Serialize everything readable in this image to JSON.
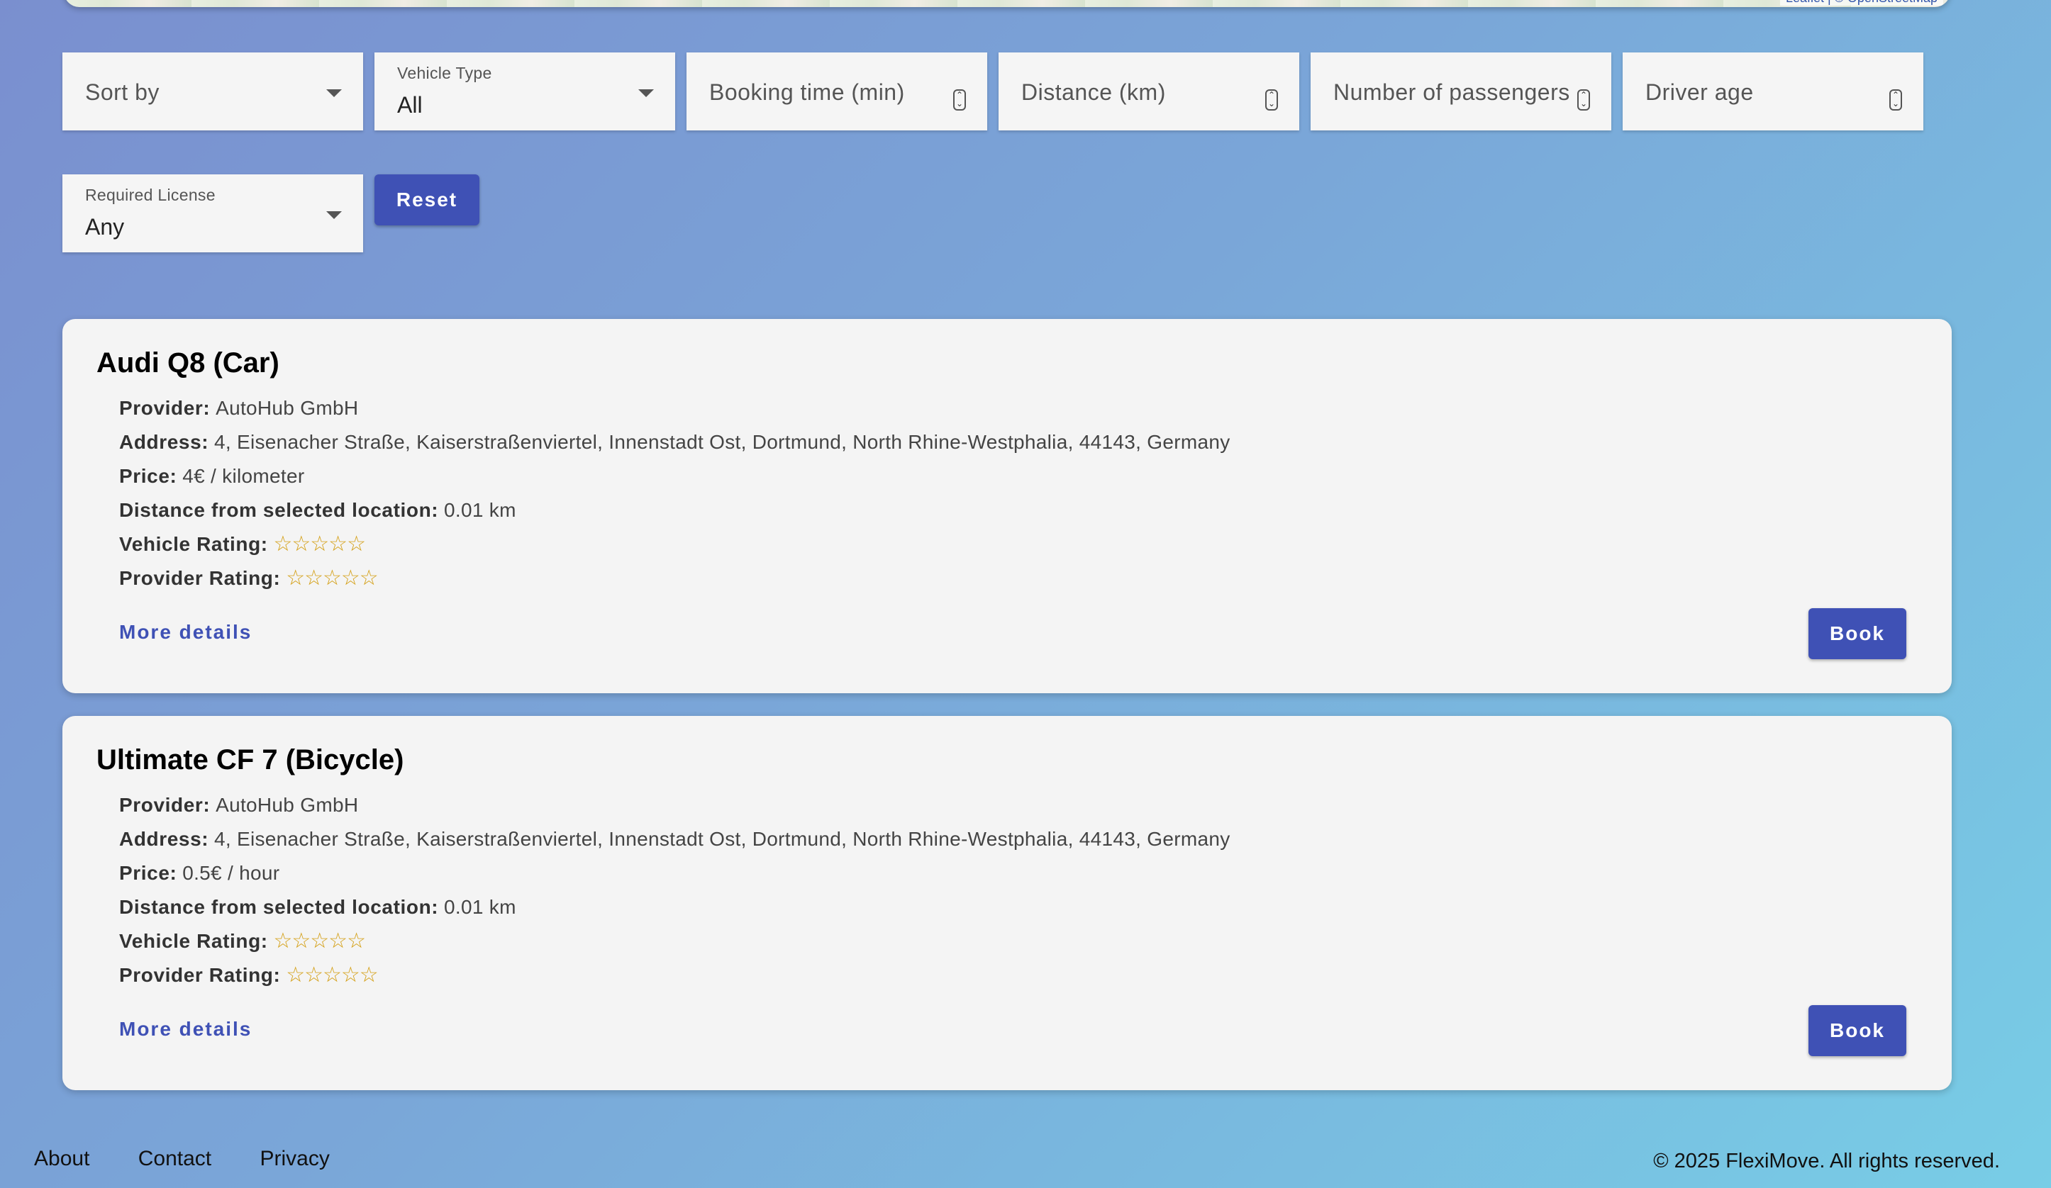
{
  "map": {
    "attribution": "Leaflet | © OpenStreetMap"
  },
  "filters": {
    "sort_by": {
      "placeholder": "Sort by"
    },
    "vehicle_type": {
      "label": "Vehicle Type",
      "value": "All"
    },
    "booking_time": {
      "placeholder": "Booking time (min)"
    },
    "distance": {
      "placeholder": "Distance (km)"
    },
    "passengers": {
      "placeholder": "Number of passengers"
    },
    "driver_age": {
      "placeholder": "Driver age"
    },
    "required_license": {
      "label": "Required License",
      "value": "Any"
    },
    "reset_label": "Reset"
  },
  "listings": [
    {
      "title": "Audi Q8 (Car)",
      "provider_label": "Provider:",
      "provider": "AutoHub GmbH",
      "address_label": "Address:",
      "address": "4, Eisenacher Straße, Kaiserstraßenviertel, Innenstadt Ost, Dortmund, North Rhine-Westphalia, 44143, Germany",
      "price_label": "Price:",
      "price": "4€ / kilometer",
      "distance_label": "Distance from selected location:",
      "distance": "0.01 km",
      "vehicle_rating_label": "Vehicle Rating:",
      "vehicle_rating_stars": "☆☆☆☆☆",
      "vehicle_rating": 0,
      "provider_rating_label": "Provider Rating:",
      "provider_rating_stars": "☆☆☆☆☆",
      "provider_rating": 0,
      "more_label": "More details",
      "book_label": "Book"
    },
    {
      "title": "Ultimate CF 7 (Bicycle)",
      "provider_label": "Provider:",
      "provider": "AutoHub GmbH",
      "address_label": "Address:",
      "address": "4, Eisenacher Straße, Kaiserstraßenviertel, Innenstadt Ost, Dortmund, North Rhine-Westphalia, 44143, Germany",
      "price_label": "Price:",
      "price": "0.5€ / hour",
      "distance_label": "Distance from selected location:",
      "distance": "0.01 km",
      "vehicle_rating_label": "Vehicle Rating:",
      "vehicle_rating_stars": "☆☆☆☆☆",
      "vehicle_rating": 0,
      "provider_rating_label": "Provider Rating:",
      "provider_rating_stars": "☆☆☆☆☆",
      "provider_rating": 0,
      "more_label": "More details",
      "book_label": "Book"
    }
  ],
  "footer": {
    "links": [
      "About",
      "Contact",
      "Privacy"
    ],
    "copyright": "© 2025 FlexiMove. All rights reserved."
  },
  "colors": {
    "accent": "#3f51b5",
    "star": "#d4a017"
  }
}
